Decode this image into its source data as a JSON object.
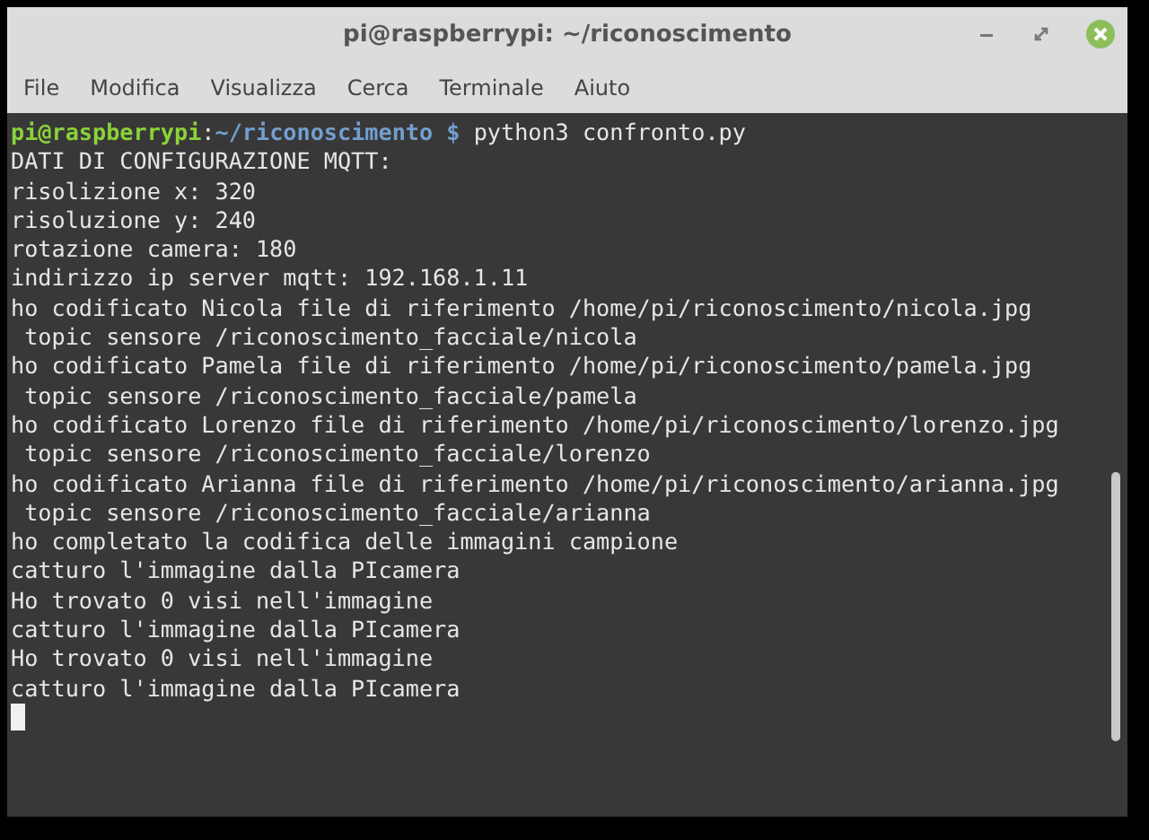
{
  "window": {
    "title": "pi@raspberrypi: ~/riconoscimento"
  },
  "menu": [
    "File",
    "Modifica",
    "Visualizza",
    "Cerca",
    "Terminale",
    "Aiuto"
  ],
  "terminal": {
    "prompt": {
      "user_host": "pi@raspberrypi",
      "separator": ":",
      "path": "~/riconoscimento $",
      "command": " python3 confronto.py"
    },
    "lines": [
      "DATI DI CONFIGURAZIONE MQTT:",
      "risolizione x: 320",
      "risoluzione y: 240",
      "rotazione camera: 180",
      "indirizzo ip server mqtt: 192.168.1.11",
      "ho codificato Nicola file di riferimento /home/pi/riconoscimento/nicola.jpg",
      " topic sensore /riconoscimento_facciale/nicola",
      "ho codificato Pamela file di riferimento /home/pi/riconoscimento/pamela.jpg",
      " topic sensore /riconoscimento_facciale/pamela",
      "ho codificato Lorenzo file di riferimento /home/pi/riconoscimento/lorenzo.jpg",
      " topic sensore /riconoscimento_facciale/lorenzo",
      "ho codificato Arianna file di riferimento /home/pi/riconoscimento/arianna.jpg",
      " topic sensore /riconoscimento_facciale/arianna",
      "ho completato la codifica delle immagini campione",
      "catturo l'immagine dalla PIcamera",
      "Ho trovato 0 visi nell'immagine",
      "catturo l'immagine dalla PIcamera",
      "Ho trovato 0 visi nell'immagine",
      "catturo l'immagine dalla PIcamera"
    ]
  }
}
